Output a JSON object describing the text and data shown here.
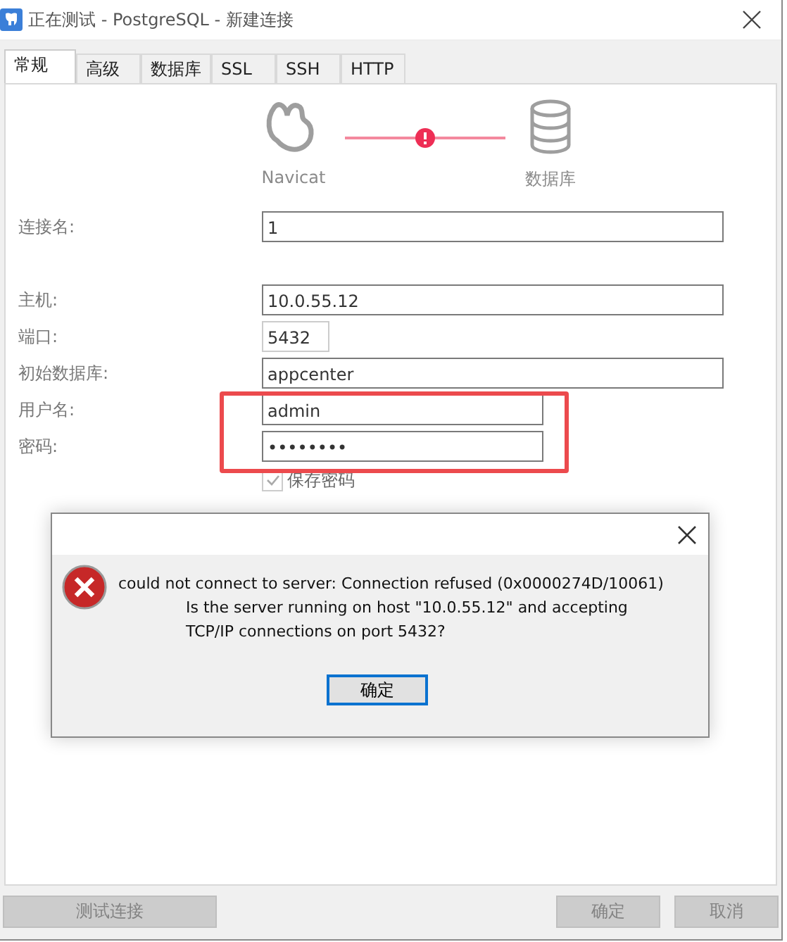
{
  "window": {
    "title": "正在测试 - PostgreSQL - 新建连接"
  },
  "tabs": [
    {
      "label": "常规",
      "selected": true
    },
    {
      "label": "高级",
      "selected": false
    },
    {
      "label": "数据库",
      "selected": false
    },
    {
      "label": "SSL",
      "selected": false
    },
    {
      "label": "SSH",
      "selected": false
    },
    {
      "label": "HTTP",
      "selected": false
    }
  ],
  "diagram": {
    "source": "Navicat",
    "target": "数据库"
  },
  "fields": [
    {
      "label": "连接名:",
      "value": "1"
    },
    {
      "label": "主机:",
      "value": "10.0.55.12"
    },
    {
      "label": "端口:",
      "value": "5432"
    },
    {
      "label": "初始数据库:",
      "value": "appcenter"
    },
    {
      "label": "用户名:",
      "value": "admin"
    },
    {
      "label": "密码:",
      "value": "••••••••"
    }
  ],
  "save_password": {
    "label": "保存密码",
    "checked": true,
    "disabled": true
  },
  "buttons": [
    {
      "label": "测试连接",
      "disabled": true
    },
    {
      "label": "确定",
      "disabled": true
    },
    {
      "label": "取消",
      "disabled": true
    }
  ],
  "error_dialog": {
    "message_lines": [
      "could not connect to server: Connection refused (0x0000274D/10061)",
      "Is the server running on host \"10.0.55.12\" and accepting",
      "TCP/IP connections on port 5432?"
    ],
    "button": "确定"
  }
}
